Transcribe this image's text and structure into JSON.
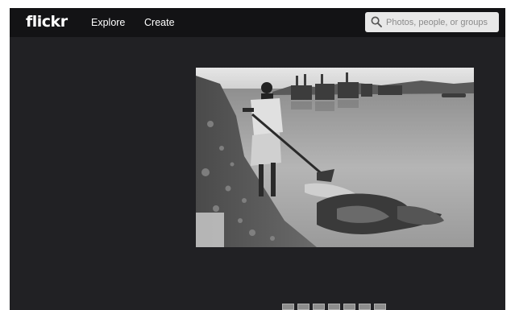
{
  "header": {
    "logo": "flickr",
    "nav": [
      {
        "label": "Explore"
      },
      {
        "label": "Create"
      }
    ],
    "search": {
      "placeholder": "Photos, people, or groups",
      "value": "",
      "icon": "search-icon"
    }
  },
  "colors": {
    "page_background": "#212124",
    "topbar_background": "#131315",
    "search_background": "#e8e8e8"
  },
  "photo": {
    "style": "black-and-white photograph"
  },
  "filmstrip": {
    "thumbnail_count": 7
  }
}
